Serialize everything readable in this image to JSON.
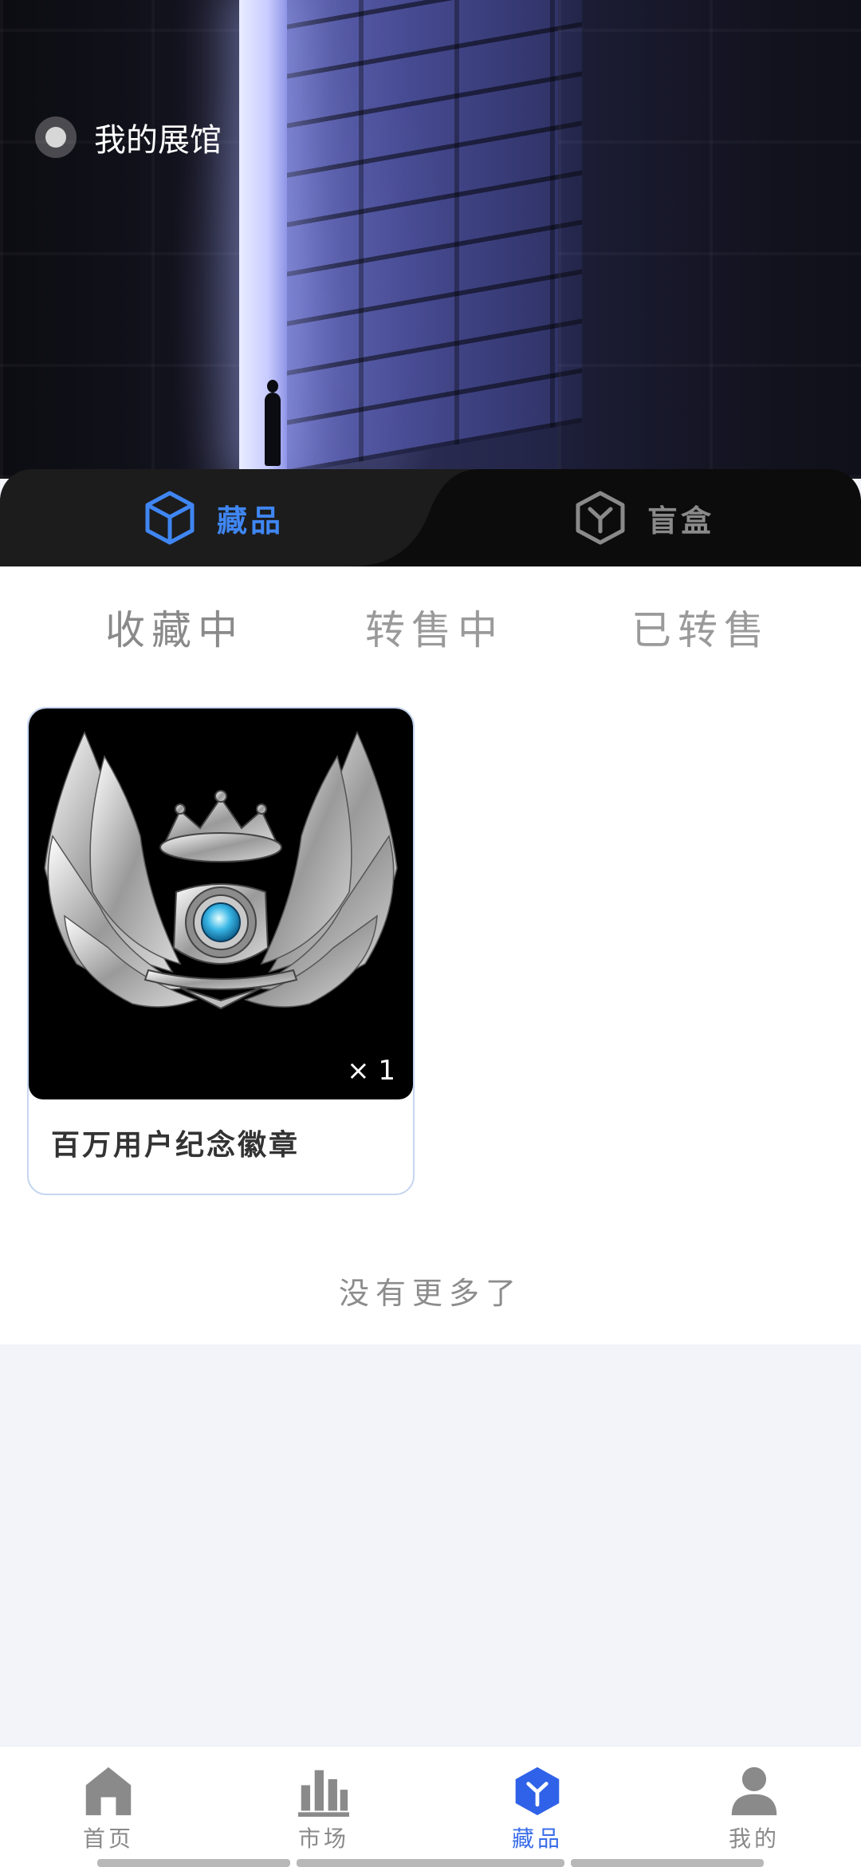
{
  "header": {
    "gallery_label": "我的展馆"
  },
  "category_tabs": [
    {
      "label": "藏品",
      "icon": "cube-icon",
      "active": true
    },
    {
      "label": "盲盒",
      "icon": "hexagon-box-icon",
      "active": false
    }
  ],
  "sub_tabs": [
    {
      "label": "收藏中",
      "active": true
    },
    {
      "label": "转售中",
      "active": false
    },
    {
      "label": "已转售",
      "active": false
    }
  ],
  "collection": [
    {
      "name": "百万用户纪念徽章",
      "quantity": "× 1",
      "image": "winged-crown-badge"
    }
  ],
  "end_of_list": "没有更多了",
  "bottom_nav": [
    {
      "label": "首页",
      "icon": "home-icon",
      "active": false
    },
    {
      "label": "市场",
      "icon": "market-bars-icon",
      "active": false
    },
    {
      "label": "藏品",
      "icon": "collection-hex-icon",
      "active": true
    },
    {
      "label": "我的",
      "icon": "profile-icon",
      "active": false
    }
  ],
  "colors": {
    "accent": "#3f86f2",
    "nav_active": "#3a6de8",
    "inactive_text": "#8a8a8a",
    "category_bar_bg": "#0c0c0c",
    "category_active_bg": "#1c1c1c",
    "page_bg": "#f2f4fa"
  }
}
